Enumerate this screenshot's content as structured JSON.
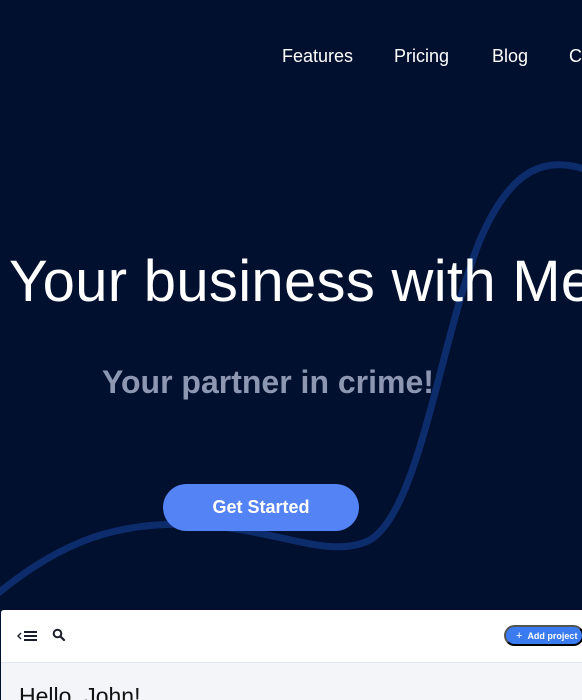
{
  "nav": {
    "items": [
      {
        "label": "Features"
      },
      {
        "label": "Pricing"
      },
      {
        "label": "Blog"
      },
      {
        "label": "C"
      }
    ]
  },
  "hero": {
    "headline": "Your business with Me",
    "tagline": "Your partner in crime!",
    "cta_label": "Get Started",
    "colors": {
      "background": "#02102f",
      "curve": "#0d2c6b",
      "cta": "#5483f5",
      "tagline": "#8d97b2"
    }
  },
  "app": {
    "toolbar": {
      "menu_icon": "menu-collapse-icon",
      "search_icon": "search-icon",
      "add_project_icon": "plus-icon",
      "add_project_label": "Add project"
    },
    "greeting": "Hello, John!",
    "colors": {
      "accent": "#3b7bf0"
    }
  }
}
